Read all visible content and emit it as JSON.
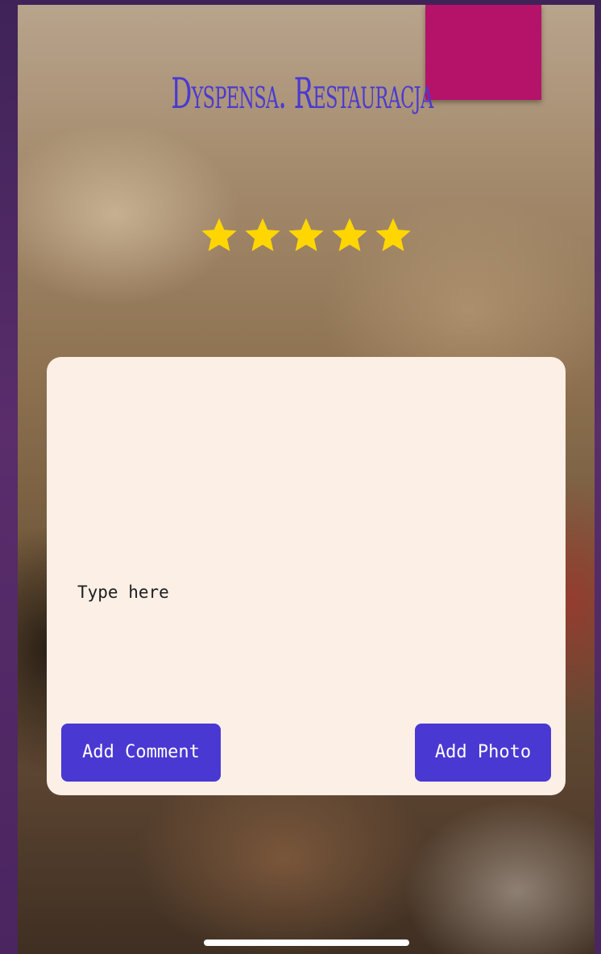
{
  "restaurant": {
    "name": "Dyspensa. Restauracja"
  },
  "rating": {
    "value": 5,
    "max": 5,
    "star_color": "#FFD600"
  },
  "comment": {
    "placeholder": "Type here",
    "value": ""
  },
  "actions": {
    "add_comment_label": "Add Comment",
    "add_photo_label": "Add Photo"
  },
  "colors": {
    "accent": "#4A38D2",
    "card_background": "#FBEFE6",
    "sticky_note": "#B5126A"
  }
}
